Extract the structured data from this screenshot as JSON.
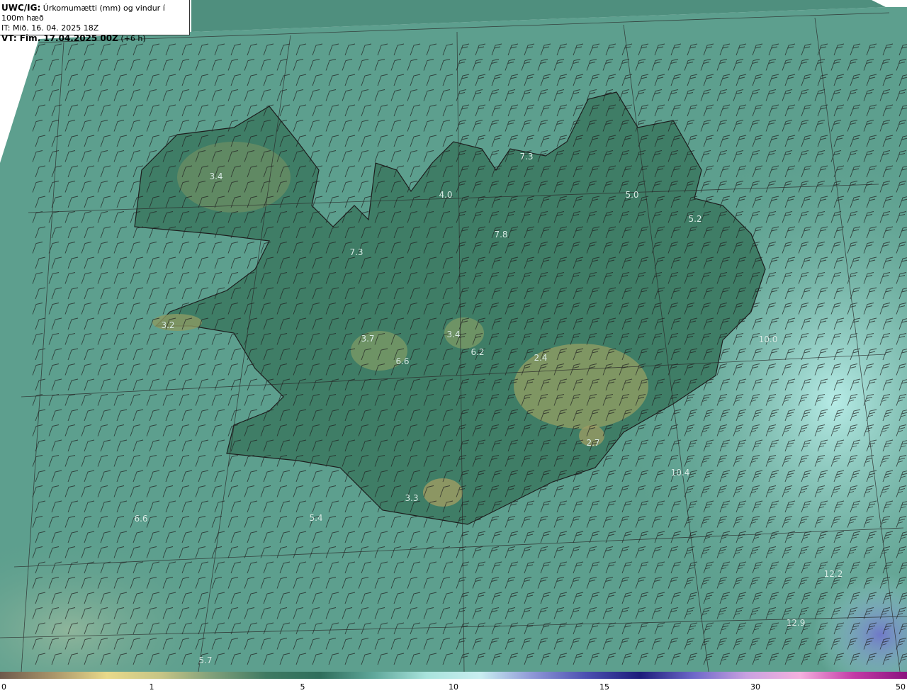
{
  "header": {
    "model": "UWC/IG:",
    "title": "Úrkomumætti (mm) og vindur í 100m hæð",
    "it_line": "IT: Mið. 16. 04. 2025 18Z",
    "vt_prefix": "VT: Fim. 17.04.2025 00Z",
    "vt_suffix": "(+6 h)"
  },
  "value_labels": [
    "3.4",
    "7.3",
    "4.0",
    "5.0",
    "5.2",
    "7.8",
    "7.3",
    "3.2",
    "3.7",
    "3.4",
    "6.6",
    "6.2",
    "2.4",
    "10.0",
    "2.7",
    "3.3",
    "6.6",
    "10.4",
    "12.2",
    "12.9",
    "5.7",
    "5.4"
  ],
  "colorbar": {
    "tick_labels": [
      "0",
      "1",
      "5",
      "10",
      "15",
      "30",
      "50"
    ],
    "colors": [
      "#6e5a4c",
      "#a9956a",
      "#e8d98a",
      "#c7c586",
      "#7f9f7a",
      "#3f7a62",
      "#2f6e5c",
      "#5fa79a",
      "#a8e3dc",
      "#c9eef0",
      "#8d96d6",
      "#4b4fb0",
      "#1c1c7a",
      "#6e68c9",
      "#c9a1e0",
      "#f4b0de",
      "#c33aa6",
      "#8a127f"
    ]
  },
  "map_colors": {
    "sea": "#5d9f8e",
    "land": "#3f7d66",
    "highland": "#9c9a5f",
    "wet_east": "#a9e6df",
    "heavy": "#7f86cf",
    "outside": "#ffffff",
    "barb": "#222222",
    "grid": "#2a2a2a"
  }
}
